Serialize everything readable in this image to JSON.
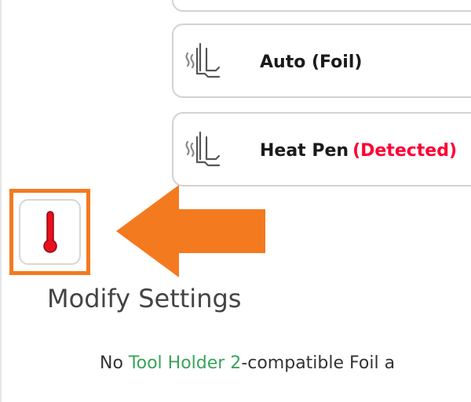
{
  "cards": [
    {
      "label": "",
      "status": ""
    },
    {
      "label": "Auto (Foil)",
      "status": ""
    },
    {
      "label": "Heat Pen",
      "status": "(Detected)"
    }
  ],
  "settings": {
    "title": "Modify Settings",
    "icon": "thermometer-icon"
  },
  "notice": {
    "prefix": "No ",
    "tool_name": "Tool Holder 2",
    "suffix": "-compatible Foil a"
  },
  "colors": {
    "highlight": "#f47a1f",
    "detected": "#ff0033",
    "tool_link": "#3aa35a",
    "thermometer": "#e8101e"
  }
}
